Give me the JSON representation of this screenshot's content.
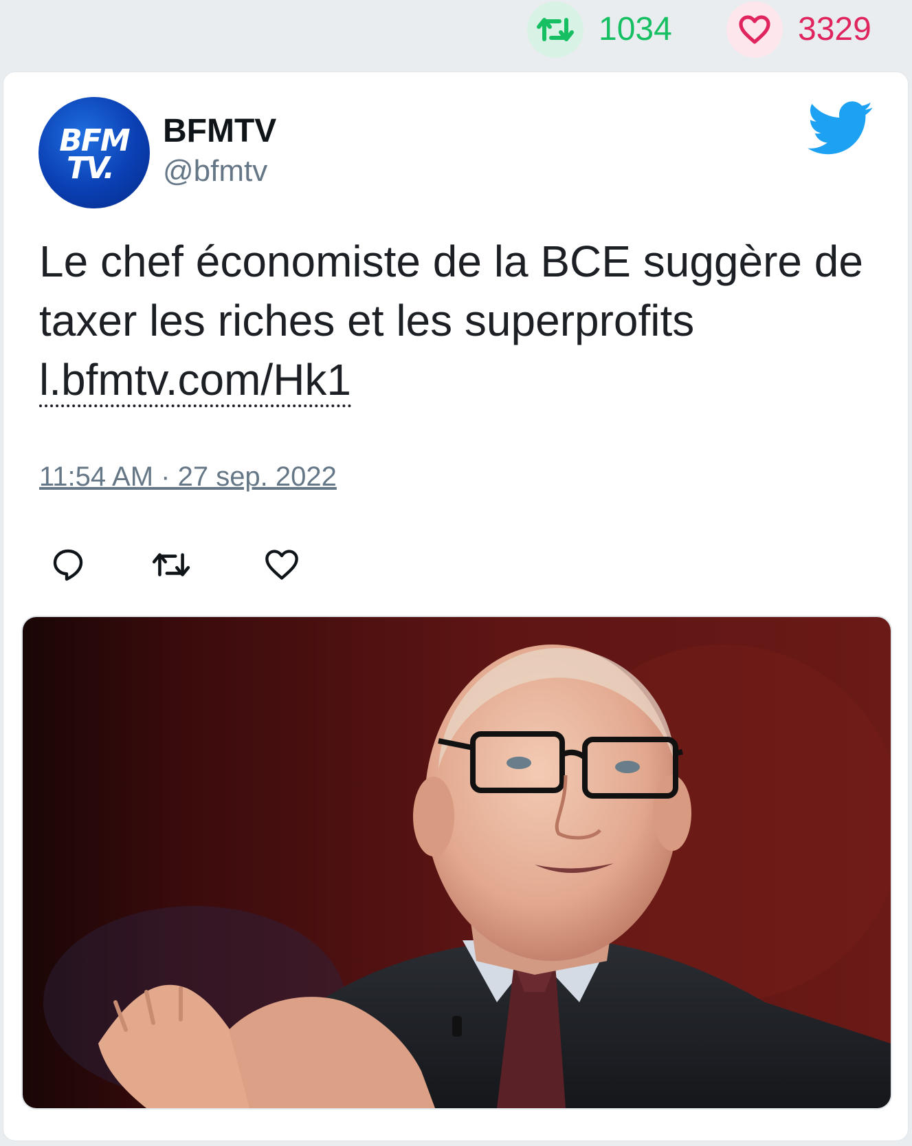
{
  "stats": {
    "retweet_icon": "retweet-icon",
    "retweet_count": "1034",
    "like_icon": "heart-icon",
    "like_count": "3329"
  },
  "tweet": {
    "author": {
      "name": "BFMTV",
      "handle": "@bfmtv",
      "avatar_text_line1": "BFM",
      "avatar_text_line2": "TV."
    },
    "text": "Le chef économiste de la BCE suggère de taxer les riches et les superprofits",
    "link": "l.bfmtv.com/Hk1",
    "timestamp": "11:54 AM · 27 sep. 2022",
    "actions": {
      "reply_icon": "reply-icon",
      "retweet_icon": "retweet-icon",
      "like_icon": "heart-icon"
    },
    "media": {
      "icon": "photo-icon"
    }
  },
  "colors": {
    "retweet_green": "#17bf63",
    "like_red": "#e0245e",
    "twitter_blue": "#1da1f2",
    "handle_gray": "#657786",
    "background": "#e9edf0"
  }
}
